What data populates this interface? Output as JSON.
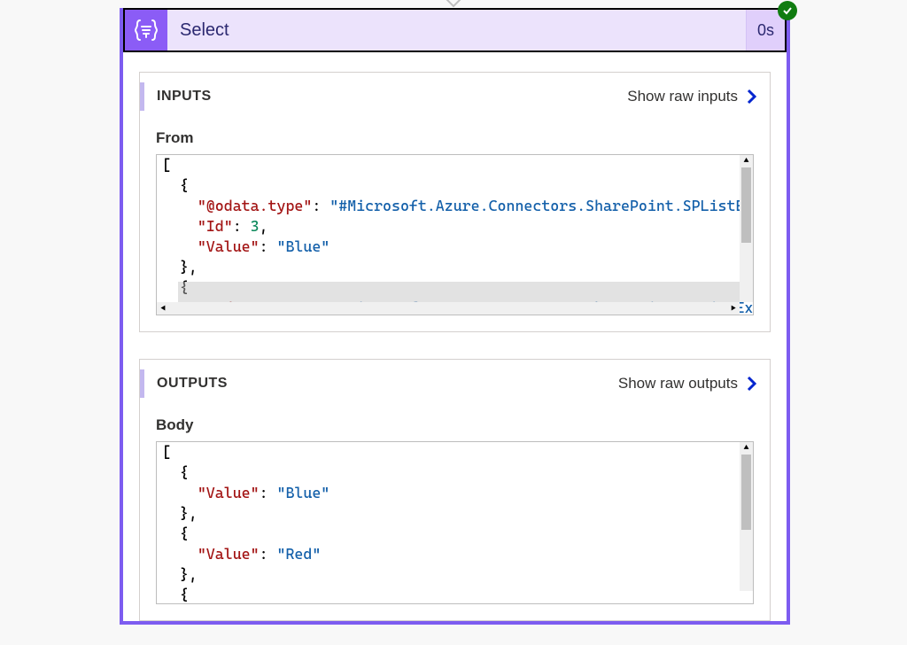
{
  "action": {
    "title": "Select",
    "duration": "0s",
    "icon": "braces-filter-icon",
    "status": "succeeded"
  },
  "inputs": {
    "title": "INPUTS",
    "rawLink": "Show raw inputs",
    "field": "From",
    "json": {
      "lines": [
        {
          "type": "punc",
          "indent": 0,
          "text": "["
        },
        {
          "type": "punc",
          "indent": 1,
          "text": "{"
        },
        {
          "type": "pair",
          "indent": 2,
          "key": "\"@odata.type\"",
          "sep": ": ",
          "valType": "str",
          "val": "\"#Microsoft.Azure.Connectors.SharePoint.SPListExpand"
        },
        {
          "type": "pair",
          "indent": 2,
          "key": "\"Id\"",
          "sep": ": ",
          "valType": "num",
          "val": "3",
          "trail": ","
        },
        {
          "type": "pair",
          "indent": 2,
          "key": "\"Value\"",
          "sep": ": ",
          "valType": "str",
          "val": "\"Blue\""
        },
        {
          "type": "punc",
          "indent": 1,
          "text": "},"
        },
        {
          "type": "punc",
          "indent": 1,
          "text": "{"
        },
        {
          "type": "pair",
          "indent": 2,
          "key": "\"@odata.type\"",
          "sep": ": ",
          "valType": "str",
          "val": "\"#Microsoft.Azure.Connectors.SharePoint.SPListExpand",
          "highlight": true
        }
      ]
    }
  },
  "outputs": {
    "title": "OUTPUTS",
    "rawLink": "Show raw outputs",
    "field": "Body",
    "json": {
      "lines": [
        {
          "type": "punc",
          "indent": 0,
          "text": "["
        },
        {
          "type": "punc",
          "indent": 1,
          "text": "{"
        },
        {
          "type": "pair",
          "indent": 2,
          "key": "\"Value\"",
          "sep": ": ",
          "valType": "str",
          "val": "\"Blue\""
        },
        {
          "type": "punc",
          "indent": 1,
          "text": "},"
        },
        {
          "type": "punc",
          "indent": 1,
          "text": "{"
        },
        {
          "type": "pair",
          "indent": 2,
          "key": "\"Value\"",
          "sep": ": ",
          "valType": "str",
          "val": "\"Red\""
        },
        {
          "type": "punc",
          "indent": 1,
          "text": "},"
        },
        {
          "type": "punc",
          "indent": 1,
          "text": "{"
        }
      ]
    }
  }
}
